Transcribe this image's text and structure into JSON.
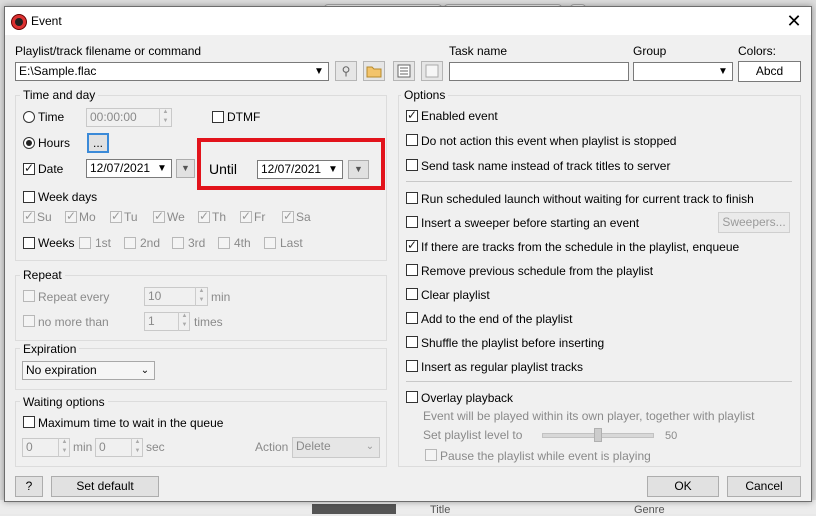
{
  "dialog": {
    "title": "Event",
    "playlist_label": "Playlist/track filename or command",
    "playlist_value": "E:\\Sample.flac",
    "task_name_label": "Task name",
    "task_name_value": "",
    "group_label": "Group",
    "group_value": "",
    "colors_label": "Colors:",
    "colors_sample": "Abcd"
  },
  "time_and_day": {
    "title": "Time and day",
    "time_label": "Time",
    "time_value": "00:00:00",
    "dtmf_label": "DTMF",
    "hours_label": "Hours",
    "hours_button": "...",
    "date_label": "Date",
    "date_value": "12/07/2021",
    "until_label": "Until",
    "until_value": "12/07/2021",
    "week_days_label": "Week days",
    "days": [
      "Su",
      "Mo",
      "Tu",
      "We",
      "Th",
      "Fr",
      "Sa"
    ],
    "weeks_label": "Weeks",
    "weeks": [
      "1st",
      "2nd",
      "3rd",
      "4th",
      "Last"
    ]
  },
  "repeat": {
    "title": "Repeat",
    "repeat_every_label": "Repeat every",
    "repeat_every_value": "10",
    "repeat_unit": "min",
    "no_more_than_label": "no more than",
    "no_more_than_value": "1",
    "no_more_than_unit": "times"
  },
  "expiration": {
    "title": "Expiration",
    "value": "No expiration"
  },
  "waiting": {
    "title": "Waiting options",
    "max_time_label": "Maximum time to wait in the queue",
    "min_value": "0",
    "min_unit": "min",
    "sec_value": "0",
    "sec_unit": "sec",
    "action_label": "Action",
    "action_value": "Delete"
  },
  "options": {
    "title": "Options",
    "enabled_event": "Enabled event",
    "do_not_action": "Do not action this event when playlist is stopped",
    "send_task_name": "Send task name instead of track titles to server",
    "run_scheduled": "Run scheduled launch without waiting for current track to finish",
    "insert_sweeper": "Insert a sweeper before starting an event",
    "sweepers_button": "Sweepers...",
    "if_tracks_enqueue": "If there are tracks from the schedule in the playlist, enqueue",
    "remove_previous": "Remove previous schedule from the playlist",
    "clear_playlist": "Clear playlist",
    "add_to_end": "Add to the end of the playlist",
    "shuffle": "Shuffle the playlist before inserting",
    "insert_regular": "Insert as regular playlist tracks",
    "overlay": "Overlay playback",
    "overlay_desc": "Event will be played within its own player, together with playlist",
    "set_level_label": "Set playlist level to",
    "level_value": "50",
    "pause_playlist": "Pause the playlist while event is playing"
  },
  "footer": {
    "help": "?",
    "set_default": "Set default",
    "ok": "OK",
    "cancel": "Cancel"
  },
  "background": {
    "bottom_title": "Title",
    "bottom_genre": "Genre"
  }
}
